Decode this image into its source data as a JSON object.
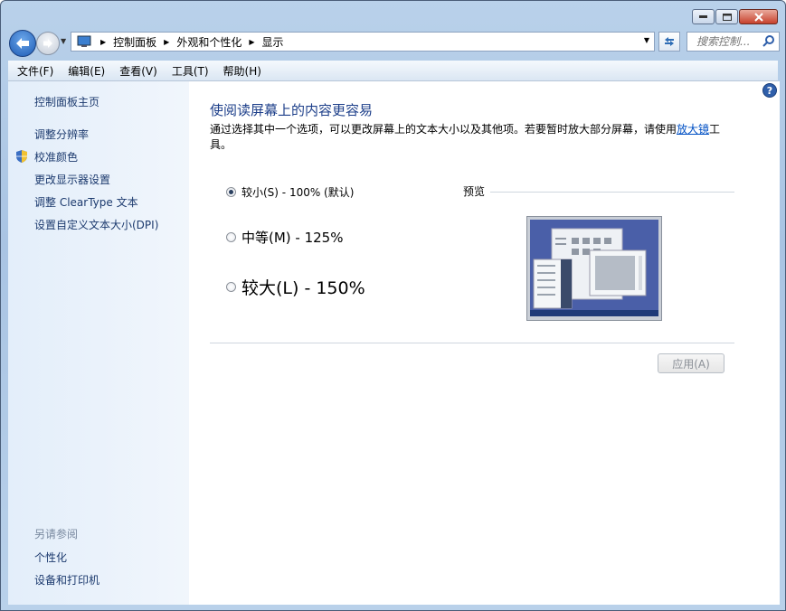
{
  "window": {
    "minimize": "minimize",
    "maximize": "maximize",
    "close": "close"
  },
  "address": {
    "segments": [
      "控制面板",
      "外观和个性化",
      "显示"
    ],
    "search_placeholder": "搜索控制..."
  },
  "menu": [
    "文件(F)",
    "编辑(E)",
    "查看(V)",
    "工具(T)",
    "帮助(H)"
  ],
  "sidebar": {
    "links": [
      "控制面板主页",
      "调整分辨率",
      "校准颜色",
      "更改显示器设置",
      "调整 ClearType 文本",
      "设置自定义文本大小(DPI)"
    ],
    "see_also": "另请参阅",
    "see_also_links": [
      "个性化",
      "设备和打印机"
    ]
  },
  "main": {
    "title": "使阅读屏幕上的内容更容易",
    "desc_before": "通过选择其中一个选项，可以更改屏幕上的文本大小以及其他项。若要暂时放大部分屏幕，请使用",
    "desc_link": "放大镜",
    "desc_after": "工具。",
    "options": [
      {
        "label": "较小(S) - 100% (默认)",
        "selected": true
      },
      {
        "label": "中等(M) - 125%",
        "selected": false
      },
      {
        "label": "较大(L) - 150%",
        "selected": false
      }
    ],
    "preview_label": "预览",
    "apply_label": "应用(A)"
  }
}
